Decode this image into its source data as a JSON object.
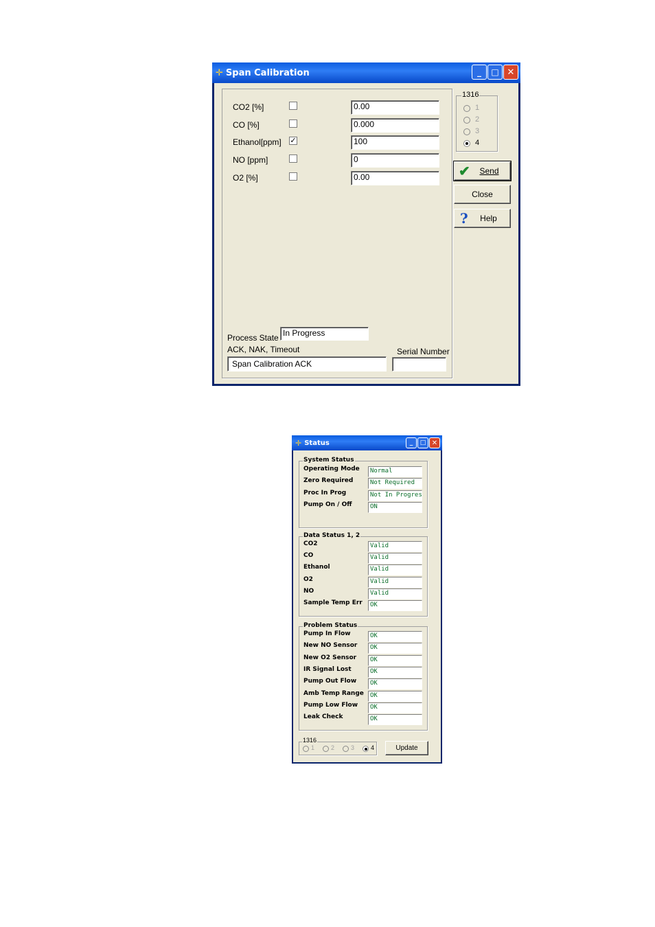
{
  "span_window": {
    "title": "Span Calibration",
    "rows": [
      {
        "label": "CO2 [%]",
        "checked": false,
        "value": "0.00"
      },
      {
        "label": "CO [%]",
        "checked": false,
        "value": "0.000"
      },
      {
        "label": "Ethanol[ppm]",
        "checked": true,
        "value": "100"
      },
      {
        "label": "NO [ppm]",
        "checked": false,
        "value": "0"
      },
      {
        "label": "O2 [%]",
        "checked": false,
        "value": "0.00"
      }
    ],
    "group_title": "1316",
    "radios": [
      "1",
      "2",
      "3",
      "4"
    ],
    "selected_radio": "4",
    "send_label": "Send",
    "close_label": "Close",
    "help_label": "Help",
    "process_state_label": "Process State",
    "process_state_value": "In Progress",
    "ack_label": "ACK, NAK, Timeout",
    "ack_value": "Span Calibration  ACK",
    "serial_label": "Serial Number",
    "serial_value": ""
  },
  "status_window": {
    "title": "Status",
    "system_status": {
      "title": "System Status",
      "rows": [
        {
          "label": "Operating Mode",
          "value": "Normal"
        },
        {
          "label": "Zero Required",
          "value": "Not Required"
        },
        {
          "label": "Proc In Prog",
          "value": "Not In Progress"
        },
        {
          "label": "Pump On / Off",
          "value": "ON"
        }
      ]
    },
    "data_status": {
      "title": "Data Status 1, 2",
      "rows": [
        {
          "label": "CO2",
          "value": "Valid"
        },
        {
          "label": "CO",
          "value": "Valid"
        },
        {
          "label": "Ethanol",
          "value": "Valid"
        },
        {
          "label": "O2",
          "value": "Valid"
        },
        {
          "label": "NO",
          "value": "Valid"
        },
        {
          "label": "Sample Temp Err",
          "value": "OK"
        }
      ]
    },
    "problem_status": {
      "title": "Problem Status",
      "rows": [
        {
          "label": "Pump In Flow",
          "value": "OK"
        },
        {
          "label": "New NO Sensor",
          "value": "OK"
        },
        {
          "label": "New O2 Sensor",
          "value": "OK"
        },
        {
          "label": "IR Signal Lost",
          "value": "OK"
        },
        {
          "label": "Pump Out Flow",
          "value": "OK"
        },
        {
          "label": "Amb Temp Range",
          "value": "OK"
        },
        {
          "label": "Pump Low Flow",
          "value": "OK"
        },
        {
          "label": "Leak Check",
          "value": "OK"
        }
      ]
    },
    "group_title": "1316",
    "radios": [
      "1",
      "2",
      "3",
      "4"
    ],
    "selected_radio": "4",
    "update_label": "Update"
  },
  "colors": {
    "titlebar": "#0a5de0",
    "dialog_bg": "#ece9d8",
    "status_text": "#0a6e2a",
    "close_button": "#d7462a"
  }
}
